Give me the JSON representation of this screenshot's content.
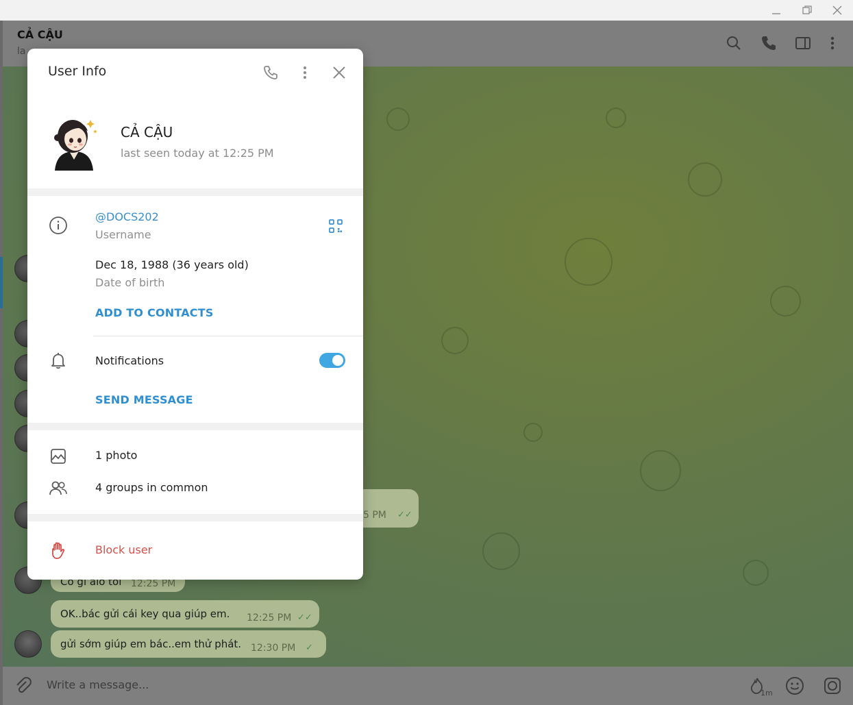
{
  "window": {
    "minimize_icon": "minimize-icon",
    "restore_icon": "restore-icon",
    "close_icon": "close-icon"
  },
  "chat_header": {
    "title": "CẢ CẬU",
    "status": "la"
  },
  "messages": [
    {
      "text": "Có gì alo tôi",
      "time": "12:25 PM",
      "outgoing": false
    },
    {
      "text": "OK..bác gửi cái key qua giúp em.",
      "time": "12:25 PM",
      "outgoing": true
    },
    {
      "text": "gửi sớm giúp em bác..em thử phát.",
      "time": "12:30 PM",
      "outgoing": true
    }
  ],
  "partial_bubble_time": "5 PM",
  "composer": {
    "placeholder": "Write a message...",
    "timer_label": "1m"
  },
  "modal": {
    "title": "User Info",
    "name": "CẢ CẬU",
    "last_seen": "last seen today at 12:25 PM",
    "username": "@DOCS202",
    "username_label": "Username",
    "birthday": "Dec 18, 1988 (36 years old)",
    "birthday_label": "Date of birth",
    "add_to_contacts": "ADD TO CONTACTS",
    "notifications_label": "Notifications",
    "notifications_on": true,
    "send_message": "SEND MESSAGE",
    "photos": "1 photo",
    "groups": "4 groups in common",
    "block": "Block user"
  },
  "colors": {
    "accent": "#40a7e3",
    "link": "#2f8fd0",
    "danger": "#d4504b"
  }
}
